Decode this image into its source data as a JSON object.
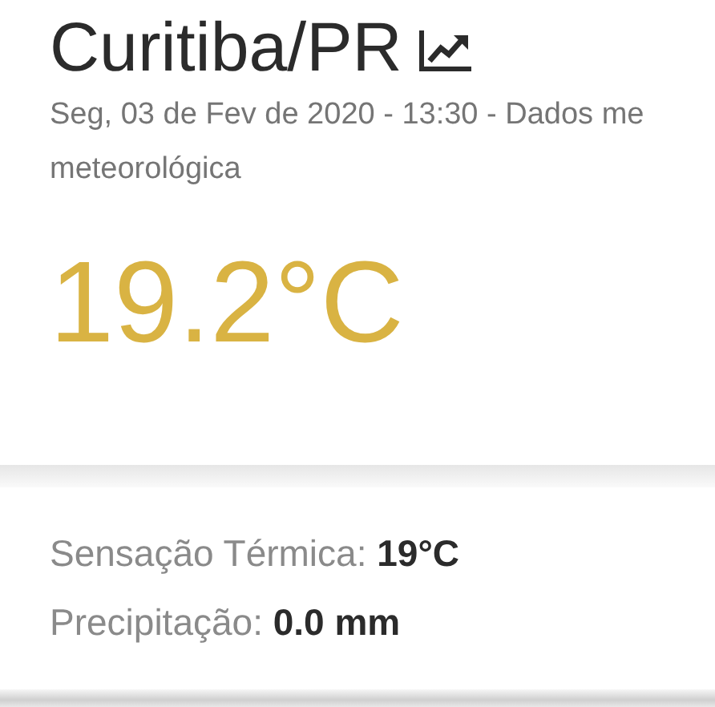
{
  "city": {
    "title": "Curitiba/PR"
  },
  "subtitle_lines": [
    "Seg, 03 de Fev de 2020 - 13:30 - Dados me",
    "meteorológica"
  ],
  "temperature": "19.2°C",
  "details": [
    {
      "label": "Sensação Térmica:",
      "value": "19°C"
    },
    {
      "label": "Precipitação:",
      "value": "0.0 mm"
    }
  ]
}
